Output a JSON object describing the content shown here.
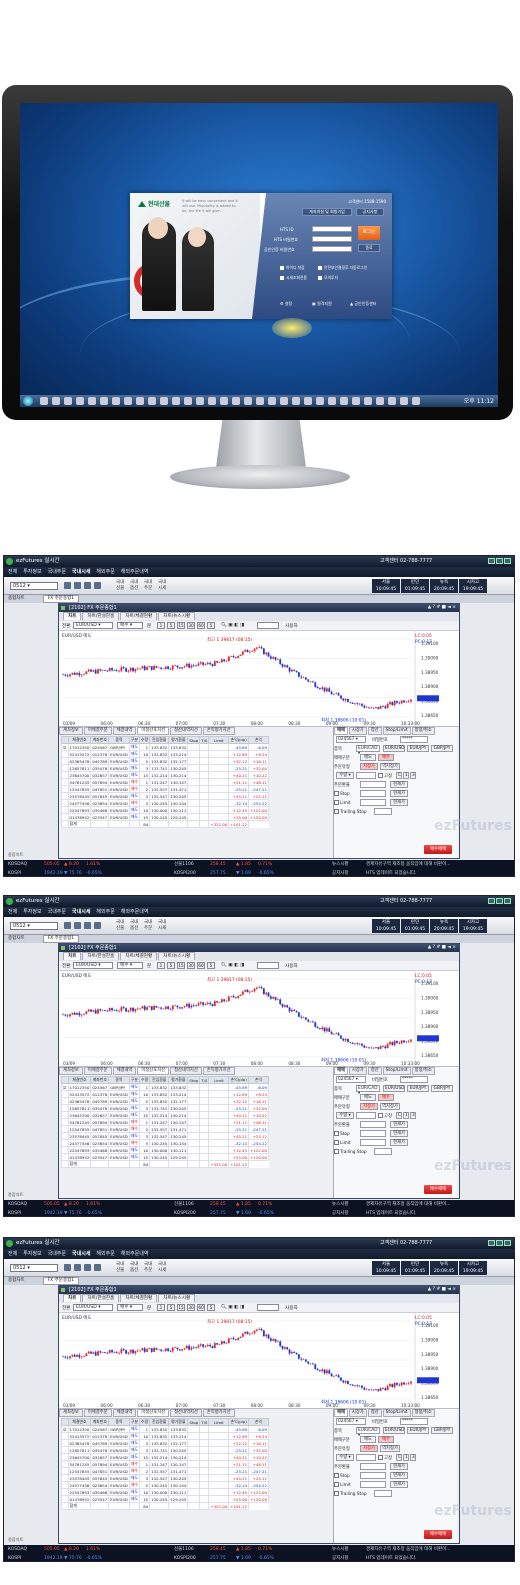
{
  "login": {
    "brand": "현대선물",
    "tagline": "It will be easy convenient and it will use. Popularity is added to be, the life it will give.",
    "hotline": "고객센터 1588-1590",
    "btn_member": "계좌개설 및 회원가입",
    "btn_notice": "공지사항",
    "labels": [
      "HTS ID",
      "HTS 비밀번호",
      "공인인증 비밀번호"
    ],
    "login_btn": "로그인",
    "cancel_btn": "종료",
    "checks": [
      "아이디 저장",
      "안전보안결정후 자동로그인",
      "시세조회전용",
      "모의투자"
    ],
    "footer": [
      "설정",
      "원격지원",
      "공인인증센터"
    ]
  },
  "taskbar": {
    "clock": "오후 11:12"
  },
  "apps": [
    {
      "title": "ezFutures",
      "subtitle": "실시간",
      "menu": [
        "전체",
        "투자정보",
        "국내주문",
        "국내시세",
        "해외주문",
        "해외주문내역"
      ],
      "menu_active": "국내시세",
      "callcenter": "고객센터 02-788-7777",
      "account": "0512",
      "toolbar_menu": [
        "국내\n선물",
        "국내\n옵션",
        "국내\n주문",
        "국내\n시세"
      ],
      "clock": [
        {
          "label": "서울",
          "time": "10:09:45"
        },
        {
          "label": "런던",
          "time": "01:09:45"
        },
        {
          "label": "뉴욕",
          "time": "20:09:45"
        },
        {
          "label": "시카고",
          "time": "19:09:45"
        }
      ],
      "nav_tab": "FX 주문종합1",
      "subnav": "종합차트",
      "inner_title": "[2102] FX 주문종합1",
      "inner_btns": "▲ ? # ■ ◄ ×",
      "chart_tabs": [
        "차트",
        "차트/한설한홈",
        "차트/체결현황",
        "차트/뉴스시황"
      ],
      "symbol_label": "전환",
      "symbol": "EUR/USD",
      "type": "매수",
      "period": "분",
      "period_vals": [
        "1",
        "5",
        "15",
        "30",
        "60",
        "5"
      ],
      "user_label": "사용자",
      "chart_label": "EUR/USD 매도",
      "hi_label": "최고 1.39817 (08:15)",
      "lo_label": "최저 1.38606 (10:01)",
      "lc_label": "LC:0.05",
      "pc_label": "PC:0.17",
      "yaxis": [
        "1.39100",
        "1.39000",
        "1.38950",
        "1.38900",
        "1.38800",
        "1.38650"
      ],
      "xaxis": [
        "03/09",
        "06:00",
        "06:30",
        "07:00",
        "07:30",
        "08:00",
        "08:30",
        "09:00",
        "09:30",
        "10:33:00"
      ],
      "ltabs": [
        "계좌정보",
        "미체결주문",
        "체결내역",
        "미청산포지션",
        "청산내역지선",
        "손익평가지선"
      ],
      "table_headers": [
        "체결번호",
        "계좌번호",
        "종목",
        "구분",
        "수량",
        "진입환율",
        "평가환율",
        "Stop",
        "T/S",
        "Limit",
        "손익(pip)",
        "손익"
      ],
      "rows": [
        [
          "17012350",
          "024567",
          "GBP/JPY",
          "매도",
          "1",
          "133.832",
          "133.832",
          "",
          "",
          "",
          "-45.89",
          "-6.09"
        ],
        [
          "52413572",
          "012378",
          "EUR/USD",
          "매도",
          "10",
          "133.832",
          "133.214",
          "",
          "",
          "",
          "+12.89",
          "+8.24"
        ],
        [
          "02365478",
          "045789",
          "EUR/USD",
          "매도",
          "5",
          "133.832",
          "132.177",
          "",
          "",
          "",
          "+32.12",
          "+16.11"
        ],
        [
          "12657811",
          "035478",
          "EUR/USD",
          "매도",
          "3",
          "133.741",
          "130.245",
          "",
          "",
          "",
          "-25.21",
          "+32.00"
        ],
        [
          "23645700",
          "032657",
          "EUR/USD",
          "매도",
          "15",
          "132.214",
          "130.214",
          "",
          "",
          "",
          "+40.21",
          "+10.22"
        ],
        [
          "54781245",
          "057894",
          "EUR/USD",
          "매수",
          "1",
          "131.247",
          "130.147",
          "",
          "",
          "",
          "+21.11",
          "+48.11"
        ],
        [
          "12547855",
          "047851",
          "EUR/USD",
          "매수",
          "2",
          "132.557",
          "131.471",
          "",
          "",
          "",
          "-25.21",
          "-247.21"
        ],
        [
          "23578445",
          "057845",
          "EUR/USD",
          "매도",
          "3",
          "132.547",
          "130.245",
          "",
          "",
          "",
          "+45.21",
          "+25.12"
        ],
        [
          "24577456",
          "023654",
          "EUR/USD",
          "매수",
          "5",
          "130.245",
          "130.144",
          "",
          "",
          "",
          "-32.14",
          "-254.22"
        ],
        [
          "22547893",
          "035468",
          "EUR/USD",
          "매도",
          "10",
          "130.000",
          "130.111",
          "",
          "",
          "",
          "+12.45",
          "+122.00"
        ],
        [
          "01478952",
          "023547",
          "EUR/USD",
          "매도",
          "15",
          "130.245",
          "129.245",
          "",
          "",
          "",
          "+25.00",
          "+120.00"
        ]
      ],
      "total_label": "합계",
      "total_qty": "84",
      "total_pip": "+321.00",
      "total_amt": "+101.22",
      "order_tabs": [
        "매매",
        "시장가",
        "청산",
        "Stop/Limit",
        "정정/취소"
      ],
      "order_account": "024567",
      "order_pw_label": "비밀번호",
      "order_pw": "*****",
      "order_symbol_label": "종목",
      "order_symbol": "EUR/CAD",
      "order_pairs": [
        "EUR/USD",
        "EUR/JPY",
        "GBP/JPY"
      ],
      "trade_label": "매매구분",
      "trade_sell": "매도",
      "trade_buy": "매수",
      "ordertype_label": "주문유형",
      "ordertype": [
        "지정가",
        "역지정가"
      ],
      "qty_label": "수량",
      "qty_fix": "고정",
      "price_label": "주문환율",
      "stop_label": "Stop",
      "limit_label": "Limit",
      "trailing_label": "Trailing Stop",
      "curr_btn": "현재가",
      "submit": "매수매매",
      "watermark": "ezFutures",
      "ticker": [
        {
          "name": "KOSDAQ",
          "val": "505.05",
          "chg": "▲ 8.20",
          "pct": "1.61%"
        },
        {
          "name": "KOSPI",
          "val": "1942.19",
          "chg": "▼ 75.76",
          "pct": "-0.65%"
        }
      ],
      "ticker_mid": [
        {
          "name": "선물1106",
          "val": "258.45",
          "chg": "▲ 1.85",
          "pct": "0.71%"
        },
        {
          "name": "KOSPI200",
          "val": "257.75",
          "chg": "▼ 1.69",
          "pct": "-0.65%"
        }
      ],
      "news": [
        {
          "label": "뉴스시황",
          "text": "경제자유구역 재조정 움직임에 대해 비판이..."
        },
        {
          "label": "공지사항",
          "text": "HTS 업데이트 되었습니다."
        }
      ]
    }
  ],
  "chart_data": {
    "type": "line",
    "title": "EUR/USD 매도",
    "xlabel": "",
    "ylabel": "",
    "x": [
      "03/09",
      "06:00",
      "06:30",
      "07:00",
      "07:30",
      "08:00",
      "08:30",
      "09:00",
      "09:30",
      "10:33:00"
    ],
    "series": [
      {
        "name": "EUR/USD",
        "values": [
          1.3928,
          1.3934,
          1.3938,
          1.3941,
          1.3946,
          1.3972,
          1.393,
          1.3896,
          1.3872,
          1.389
        ]
      }
    ],
    "ylim": [
      1.386,
      1.3985
    ],
    "grid": true
  }
}
